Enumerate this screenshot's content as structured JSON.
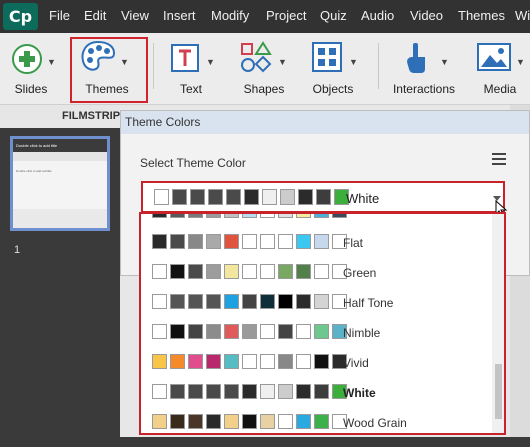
{
  "app": {
    "logo": "Cp"
  },
  "menu": [
    "File",
    "Edit",
    "View",
    "Insert",
    "Modify",
    "Project",
    "Quiz",
    "Audio",
    "Video",
    "Themes",
    "Wi"
  ],
  "toolbar": {
    "slides": "Slides",
    "themes": "Themes",
    "text": "Text",
    "shapes": "Shapes",
    "objects": "Objects",
    "interactions": "Interactions",
    "media": "Media"
  },
  "filmstrip": {
    "title": "FILMSTRIP",
    "slide_number": "1",
    "thumb_title": "Double click to add title",
    "thumb_sub": "Double click to add subtitle"
  },
  "panel": {
    "title": "Theme Colors",
    "select_label": "Select Theme Color"
  },
  "combo": {
    "selected": "White",
    "swatches": [
      "#ffffff",
      "#4a4a4a",
      "#4a4a4a",
      "#4a4a4a",
      "#4a4a4a",
      "#2b2b2b",
      "#efefef",
      "#cccccc",
      "#2b2b2b",
      "#3d3d3d",
      "#3cae3c"
    ]
  },
  "partial_row": [
    "#2a2a2a",
    "#5a5a5a",
    "#7a7a7a",
    "#9b9b9b",
    "#c0c0c0",
    "#b8dff0",
    "#ffffff",
    "#e0e0e0",
    "#f4eda0",
    "#4ab0d8",
    "#3a4a5a"
  ],
  "themes": [
    {
      "name": "Flat",
      "bold": false,
      "swatches": [
        "#2a2a2a",
        "#4a4a4a",
        "#888888",
        "#a9a9a9",
        "#e0533f",
        "#ffffff",
        "#ffffff",
        "#ffffff",
        "#3ac7f0",
        "#c8d8ec",
        "#ffffff"
      ]
    },
    {
      "name": "Green",
      "bold": false,
      "swatches": [
        "#ffffff",
        "#111111",
        "#4a4a4a",
        "#9c9c9c",
        "#f3e7a0",
        "#ffffff",
        "#ffffff",
        "#78a862",
        "#52804a",
        "#ffffff",
        "#ffffff"
      ]
    },
    {
      "name": "Half Tone",
      "bold": false,
      "swatches": [
        "#ffffff",
        "#555555",
        "#555555",
        "#555555",
        "#1ea1e0",
        "#444444",
        "#0e2e3a",
        "#000000",
        "#2b2b2b",
        "#d4d4d4",
        "#ffffff"
      ]
    },
    {
      "name": "Nimble",
      "bold": false,
      "swatches": [
        "#ffffff",
        "#0f0f0f",
        "#444444",
        "#8c8c8c",
        "#e05a5a",
        "#9a9a9a",
        "#ffffff",
        "#444444",
        "#ffffff",
        "#6ec78e",
        "#5ab3c8"
      ]
    },
    {
      "name": "Vivid",
      "bold": false,
      "swatches": [
        "#f8c54a",
        "#f58a2a",
        "#e04c8c",
        "#b8286a",
        "#55bcc4",
        "#ffffff",
        "#ffffff",
        "#888888",
        "#ffffff",
        "#111111",
        "#2a2a2a"
      ]
    },
    {
      "name": "White",
      "bold": true,
      "swatches": [
        "#ffffff",
        "#4a4a4a",
        "#4a4a4a",
        "#4a4a4a",
        "#4a4a4a",
        "#2b2b2b",
        "#efefef",
        "#cccccc",
        "#2b2b2b",
        "#3d3d3d",
        "#3cae3c"
      ]
    },
    {
      "name": "Wood Grain",
      "bold": false,
      "swatches": [
        "#f3d08a",
        "#3a2a1a",
        "#4a3628",
        "#2a2a2a",
        "#f3d08a",
        "#111111",
        "#e8d2a4",
        "#ffffff",
        "#2aa8e0",
        "#3cb04a",
        "#ffffff"
      ]
    }
  ],
  "colors": {
    "highlight": "#d0232a",
    "panel_title_bg": "#d9e3ef"
  }
}
